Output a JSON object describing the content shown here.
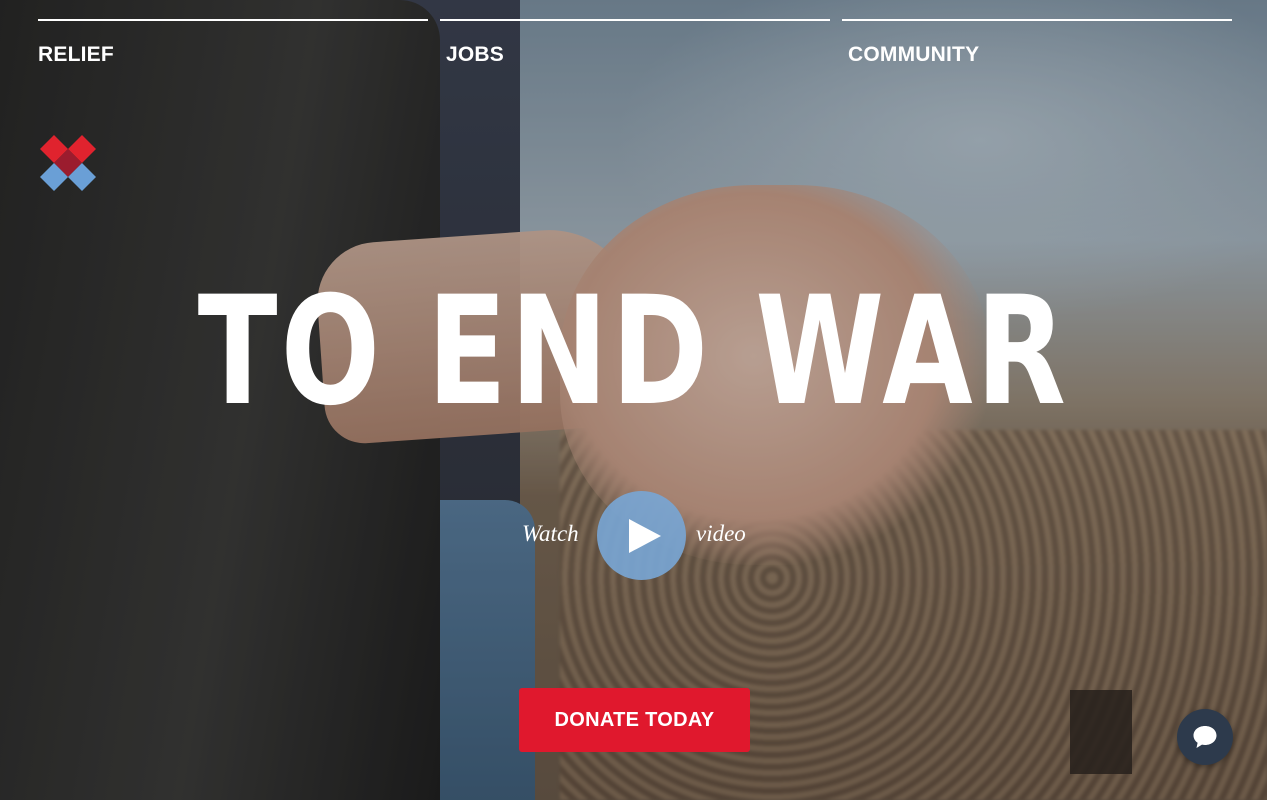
{
  "nav": {
    "items": [
      {
        "label": "RELIEF"
      },
      {
        "label": "JOBS"
      },
      {
        "label": "COMMUNITY"
      }
    ]
  },
  "hero": {
    "headline": "TO END WAR",
    "watch_label": "Watch",
    "video_label": "video",
    "play_icon": "play-icon"
  },
  "cta": {
    "donate_label": "DONATE TODAY"
  },
  "chat": {
    "icon": "chat-bubble-icon"
  },
  "colors": {
    "donate_red": "#e0182d",
    "play_blue": "#78a5d2",
    "chat_navy": "#2d3a4c",
    "logo_red": "#e0232e",
    "logo_dark_red": "#9b1c2e",
    "logo_blue": "#6a9fd6"
  }
}
